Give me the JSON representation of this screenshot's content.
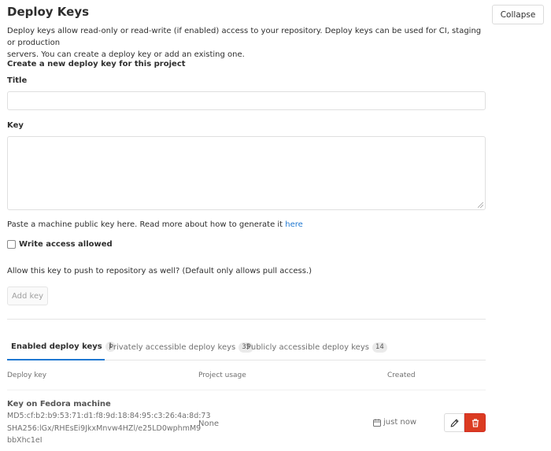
{
  "header": {
    "title": "Deploy Keys",
    "collapse_label": "Collapse",
    "description_line1": "Deploy keys allow read-only or read-write (if enabled) access to your repository. Deploy keys can be used for CI, staging or production",
    "description_line2": "servers. You can create a deploy key or add an existing one."
  },
  "form": {
    "heading": "Create a new deploy key for this project",
    "title_label": "Title",
    "title_value": "",
    "key_label": "Key",
    "key_value": "",
    "help_text": "Paste a machine public key here. Read more about how to generate it ",
    "help_link": "here",
    "write_access_label": "Write access allowed",
    "write_access_checked": false,
    "write_access_help": "Allow this key to push to repository as well? (Default only allows pull access.)",
    "submit_label": "Add key"
  },
  "tabs": [
    {
      "label": "Enabled deploy keys",
      "count": "1",
      "active": true
    },
    {
      "label": "Privately accessible deploy keys",
      "count": "35",
      "active": false
    },
    {
      "label": "Publicly accessible deploy keys",
      "count": "14",
      "active": false
    }
  ],
  "table": {
    "columns": [
      "Deploy key",
      "Project usage",
      "Created"
    ],
    "rows": [
      {
        "title": "Key on Fedora machine",
        "fingerprint_md5": "MD5:cf:b2:b9:53:71:d1:f8:9d:18:84:95:c3:26:4a:8d:73",
        "fingerprint_sha256_line1": "SHA256:lGx/RHEsEi9JkxMnvw4HZl/e25LD0wphmM9",
        "fingerprint_sha256_line2": "bbXhc1eI",
        "project_usage": "None",
        "created": "just now"
      }
    ]
  },
  "icons": {
    "edit": "pencil-icon",
    "delete": "trash-icon",
    "created": "calendar-icon"
  },
  "colors": {
    "accent": "#1f78d1",
    "danger": "#db3b21",
    "border": "#dfdfdf",
    "muted_text": "#707070"
  }
}
